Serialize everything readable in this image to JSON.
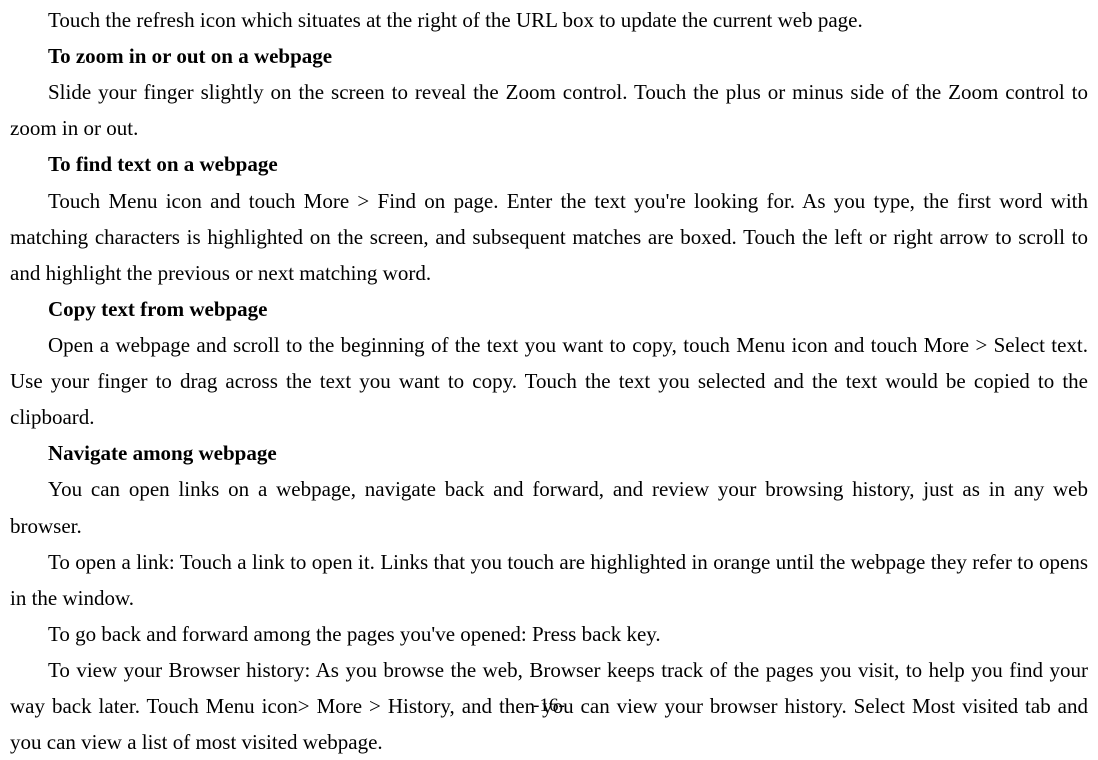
{
  "content": {
    "p1": "Touch the refresh icon which situates at the right of the URL box to update the current web page.",
    "h1": "To zoom in or out on a webpage",
    "p2": "Slide your finger slightly on the screen to reveal the Zoom control. Touch the plus or minus side of the Zoom control to zoom in or out.",
    "h2": "To find text on a webpage",
    "p3": "Touch Menu icon and touch More > Find on page. Enter the text you're looking for. As you type, the first word with matching characters is highlighted on the screen, and subsequent matches are boxed. Touch the left or right arrow to scroll to and highlight the previous or next matching word.",
    "h3": "Copy text from webpage",
    "p4": "Open a webpage and scroll to the beginning of the text you want to copy, touch Menu icon and touch More > Select text. Use your finger to drag across the text you want to copy. Touch the text you selected and the text would be copied to the clipboard.",
    "h4": "Navigate among webpage",
    "p5": "You can open links on a webpage, navigate back and forward, and review your browsing history, just as in any web browser.",
    "p6": "To open a link: Touch a link to open it. Links that you touch are highlighted in orange until the webpage they refer to opens in the window.",
    "p7": "To go back and forward among the pages you've opened: Press back key.",
    "p8": "To view your Browser history: As you browse the web, Browser keeps track of the pages you visit, to help you find your way back later. Touch Menu icon> More > History, and then you can view your browser history. Select Most visited tab and you can view a list of most visited webpage."
  },
  "page_number": "-16-"
}
